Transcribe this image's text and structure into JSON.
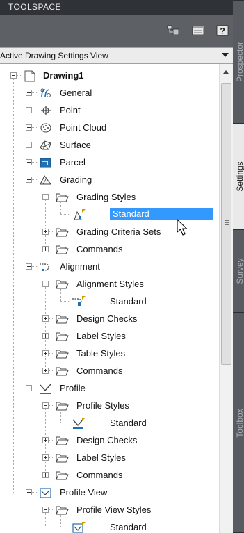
{
  "window": {
    "title": "TOOLSPACE"
  },
  "toolbar": {
    "buttons": [
      {
        "name": "display-mode-icon"
      },
      {
        "name": "item-view-icon"
      },
      {
        "name": "help-icon",
        "label": "?"
      }
    ]
  },
  "view_selector": {
    "value": "Active Drawing Settings View"
  },
  "side_tabs": [
    {
      "label": "Prospector",
      "active": false
    },
    {
      "label": "Settings",
      "active": true
    },
    {
      "label": "Survey",
      "active": false
    },
    {
      "label": "Toolbox",
      "active": false
    }
  ],
  "tree": {
    "nodes": [
      {
        "label": "Drawing1",
        "icon": "drawing-icon",
        "expander": "minus",
        "bold": true
      },
      {
        "label": "General",
        "icon": "general-settings-icon",
        "expander": "plus"
      },
      {
        "label": "Point",
        "icon": "point-icon",
        "expander": "plus"
      },
      {
        "label": "Point Cloud",
        "icon": "point-cloud-icon",
        "expander": "plus"
      },
      {
        "label": "Surface",
        "icon": "surface-icon",
        "expander": "plus"
      },
      {
        "label": "Parcel",
        "icon": "parcel-icon",
        "expander": "plus"
      },
      {
        "label": "Grading",
        "icon": "grading-icon",
        "expander": "minus"
      },
      {
        "label": "Grading Styles",
        "icon": "folder-open-icon",
        "expander": "minus"
      },
      {
        "label": "Standard",
        "icon": "grading-style-icon",
        "expander": "none",
        "selected": true
      },
      {
        "label": "Grading Criteria Sets",
        "icon": "folder-open-icon",
        "expander": "plus"
      },
      {
        "label": "Commands",
        "icon": "folder-open-icon",
        "expander": "plus"
      },
      {
        "label": "Alignment",
        "icon": "alignment-icon",
        "expander": "minus"
      },
      {
        "label": "Alignment Styles",
        "icon": "folder-open-icon",
        "expander": "minus"
      },
      {
        "label": "Standard",
        "icon": "alignment-style-icon",
        "expander": "none"
      },
      {
        "label": "Design Checks",
        "icon": "folder-open-icon",
        "expander": "plus"
      },
      {
        "label": "Label Styles",
        "icon": "folder-open-icon",
        "expander": "plus"
      },
      {
        "label": "Table Styles",
        "icon": "folder-open-icon",
        "expander": "plus"
      },
      {
        "label": "Commands",
        "icon": "folder-open-icon",
        "expander": "plus"
      },
      {
        "label": "Profile",
        "icon": "profile-icon",
        "expander": "minus"
      },
      {
        "label": "Profile Styles",
        "icon": "folder-open-icon",
        "expander": "minus"
      },
      {
        "label": "Standard",
        "icon": "profile-style-icon",
        "expander": "none"
      },
      {
        "label": "Design Checks",
        "icon": "folder-open-icon",
        "expander": "plus"
      },
      {
        "label": "Label Styles",
        "icon": "folder-open-icon",
        "expander": "plus"
      },
      {
        "label": "Commands",
        "icon": "folder-open-icon",
        "expander": "plus"
      },
      {
        "label": "Profile View",
        "icon": "profile-view-icon",
        "expander": "minus"
      },
      {
        "label": "Profile View Styles",
        "icon": "folder-open-icon",
        "expander": "minus"
      },
      {
        "label": "Standard",
        "icon": "profile-view-style-icon",
        "expander": "none"
      }
    ]
  },
  "colors": {
    "selection": "#3399ff",
    "icon_blue": "#1f6fb3",
    "style_marker": "#c8a000"
  }
}
